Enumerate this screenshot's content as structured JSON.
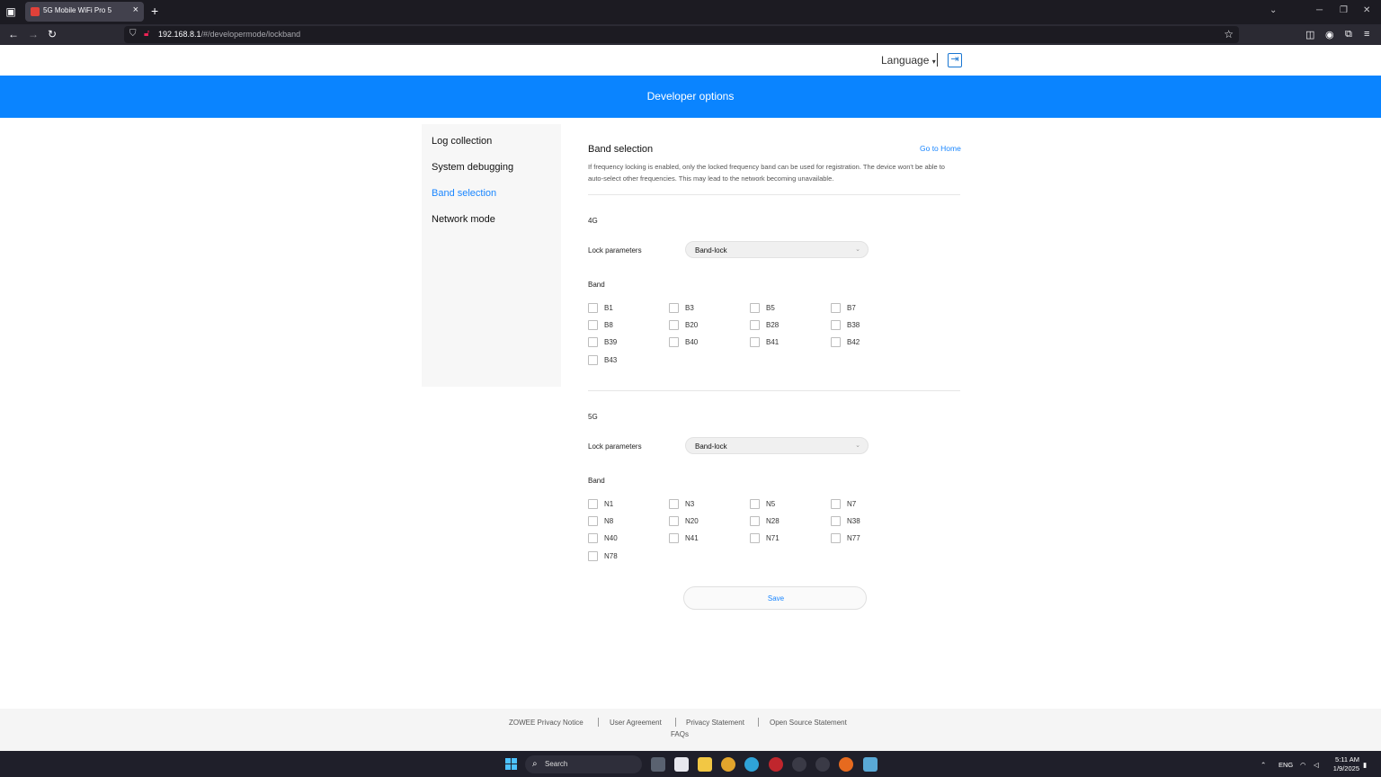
{
  "browser": {
    "tab_title": "5G Mobile WiFi Pro 5",
    "url_host": "192.168.8.1",
    "url_path": "/#/developermode/lockband"
  },
  "header": {
    "language_label": "Language",
    "banner_title": "Developer options"
  },
  "sidebar": {
    "items": [
      {
        "label": "Log collection"
      },
      {
        "label": "System debugging"
      },
      {
        "label": "Band selection"
      },
      {
        "label": "Network mode"
      }
    ]
  },
  "main": {
    "title": "Band selection",
    "goto_home": "Go to Home",
    "description": "If frequency locking is enabled, only the locked frequency band can be used for registration. The device won't be able to auto-select other frequencies. This may lead to the network becoming unavailable.",
    "lte": {
      "section": "4G",
      "lock_label": "Lock parameters",
      "lock_value": "Band-lock",
      "band_label": "Band",
      "bands": [
        "B1",
        "B3",
        "B5",
        "B7",
        "B8",
        "B20",
        "B28",
        "B38",
        "B39",
        "B40",
        "B41",
        "B42",
        "B43"
      ]
    },
    "nr": {
      "section": "5G",
      "lock_label": "Lock parameters",
      "lock_value": "Band-lock",
      "band_label": "Band",
      "bands": [
        "N1",
        "N3",
        "N5",
        "N7",
        "N8",
        "N20",
        "N28",
        "N38",
        "N40",
        "N41",
        "N71",
        "N77",
        "N78"
      ]
    },
    "save_label": "Save"
  },
  "footer": {
    "links": [
      "ZOWEE Privacy Notice",
      "User Agreement",
      "Privacy Statement",
      "Open Source Statement"
    ],
    "faq": "FAQs"
  },
  "taskbar": {
    "search_placeholder": "Search",
    "lang": "ENG",
    "time": "5:11 AM",
    "date": "1/9/2025"
  },
  "colors": {
    "accent": "#0a84ff",
    "link": "#1a86ff"
  }
}
